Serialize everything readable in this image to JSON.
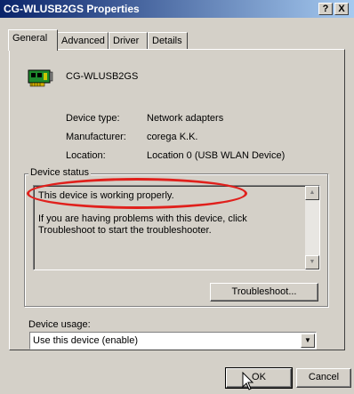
{
  "window": {
    "title": "CG-WLUSB2GS Properties",
    "help_glyph": "?",
    "close_glyph": "X"
  },
  "tabs": [
    {
      "label": "General",
      "active": true
    },
    {
      "label": "Advanced",
      "active": false
    },
    {
      "label": "Driver",
      "active": false
    },
    {
      "label": "Details",
      "active": false
    }
  ],
  "device": {
    "name": "CG-WLUSB2GS",
    "icon": "network-adapter-icon",
    "type_label": "Device type:",
    "type_value": "Network adapters",
    "manufacturer_label": "Manufacturer:",
    "manufacturer_value": "corega K.K.",
    "location_label": "Location:",
    "location_value": "Location 0 (USB WLAN Device)"
  },
  "status": {
    "group_label": "Device status",
    "line1": "This device is working properly.",
    "line2": "If you are having problems with this device, click Troubleshoot to start the troubleshooter.",
    "troubleshoot_label": "Troubleshoot...",
    "highlight_color": "#e0201c"
  },
  "usage": {
    "label": "Device usage:",
    "selected": "Use this device (enable)"
  },
  "buttons": {
    "ok": "OK",
    "cancel": "Cancel"
  }
}
